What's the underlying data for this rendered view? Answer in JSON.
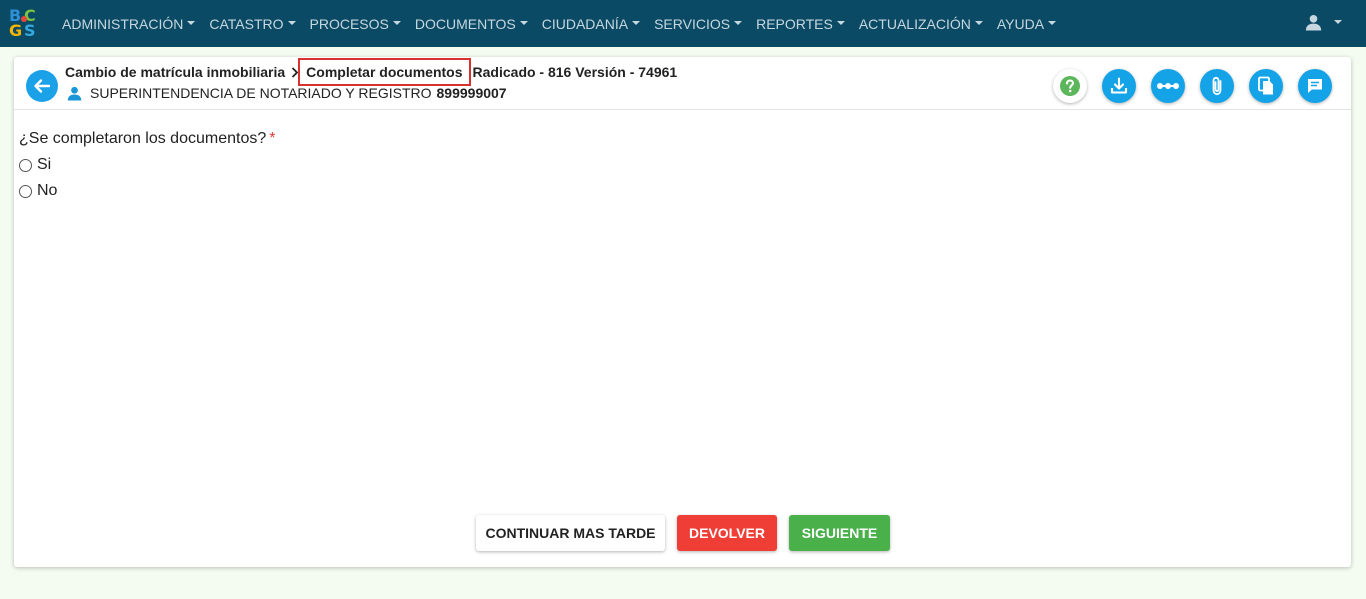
{
  "logo": {
    "letters": [
      "B",
      "C",
      "G",
      "S"
    ]
  },
  "navbar": {
    "items": [
      {
        "label": "ADMINISTRACIÓN"
      },
      {
        "label": "CATASTRO"
      },
      {
        "label": "PROCESOS"
      },
      {
        "label": "DOCUMENTOS"
      },
      {
        "label": "CIUDADANÍA"
      },
      {
        "label": "SERVICIOS"
      },
      {
        "label": "REPORTES"
      },
      {
        "label": "ACTUALIZACIÓN"
      },
      {
        "label": "AYUDA"
      }
    ],
    "user_icon": "user-icon"
  },
  "header": {
    "breadcrumb_parent": "Cambio de matrícula inmobiliaria",
    "breadcrumb_current": "Completar documentos",
    "breadcrumb_rest": "Radicado - 816 Versión - 74961",
    "organization": "SUPERINTENDENCIA DE NOTARIADO Y REGISTRO",
    "nit": "899999007",
    "actions": [
      "help-icon",
      "download-icon",
      "more-icon",
      "attachment-icon",
      "copy-icon",
      "comment-icon"
    ]
  },
  "form": {
    "question": "¿Se completaron los documentos?",
    "required_mark": "*",
    "options": [
      "Si",
      "No"
    ]
  },
  "footer": {
    "later_label": "CONTINUAR MAS TARDE",
    "return_label": "DEVOLVER",
    "next_label": "SIGUIENTE"
  },
  "colors": {
    "navbar": "#0b4a64",
    "accent": "#15a3e8",
    "danger": "#ef3e36",
    "success": "#49b04a",
    "highlight": "#d93030"
  }
}
